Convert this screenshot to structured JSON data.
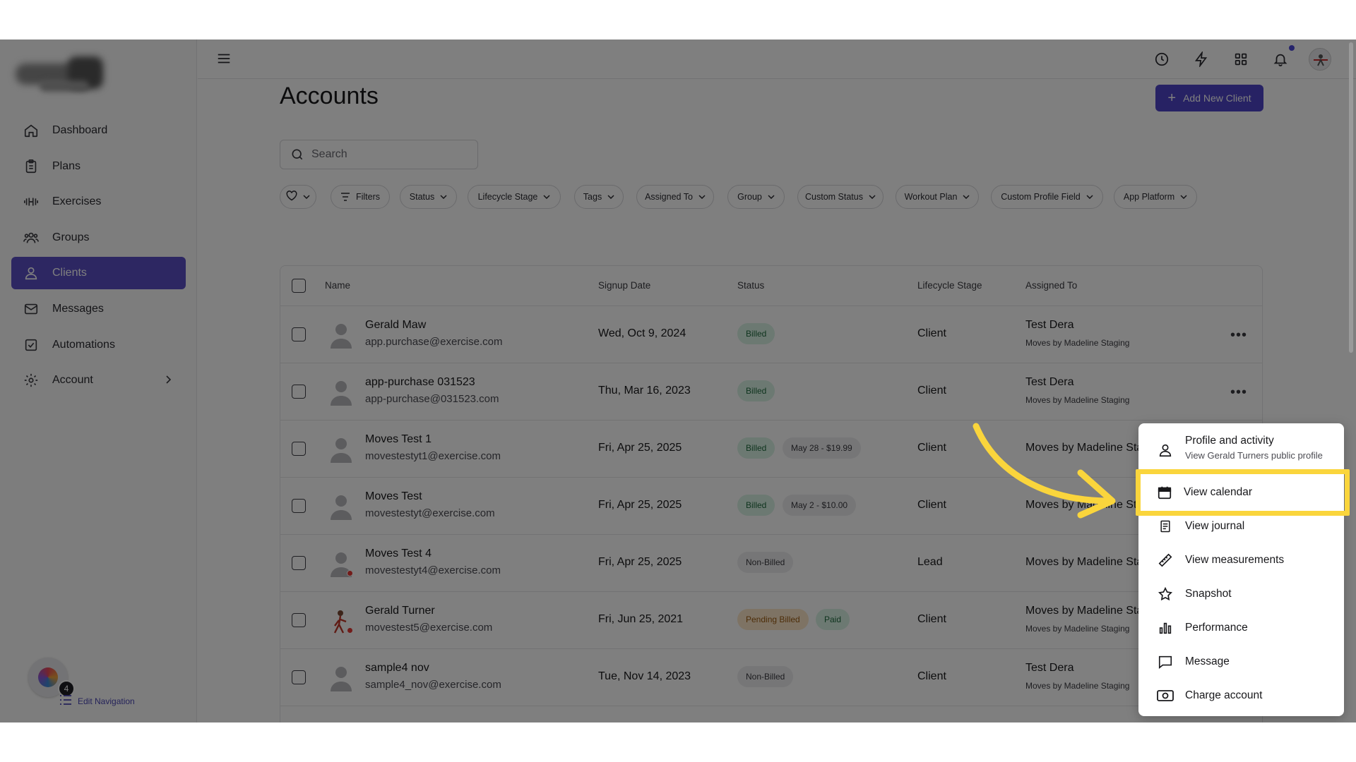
{
  "sidebar": {
    "items": [
      {
        "label": "Dashboard",
        "icon": "home-icon"
      },
      {
        "label": "Plans",
        "icon": "clipboard-icon"
      },
      {
        "label": "Exercises",
        "icon": "dumbbell-icon"
      },
      {
        "label": "Groups",
        "icon": "users-icon"
      },
      {
        "label": "Clients",
        "icon": "user-icon",
        "active": true
      },
      {
        "label": "Messages",
        "icon": "mail-icon"
      },
      {
        "label": "Automations",
        "icon": "check-square-icon"
      },
      {
        "label": "Account",
        "icon": "gear-icon"
      }
    ],
    "notification_count": "4",
    "edit_nav_label": "Edit Navigation"
  },
  "main": {
    "title": "Accounts",
    "add_button": "Add New Client",
    "search_placeholder": "Search",
    "filters": [
      "Filters",
      "Status",
      "Lifecycle Stage",
      "Tags",
      "Assigned To",
      "Group",
      "Custom Status",
      "Workout Plan",
      "Custom Profile Field",
      "App Platform"
    ]
  },
  "table": {
    "headers": {
      "name": "Name",
      "signup": "Signup Date",
      "status": "Status",
      "stage": "Lifecycle Stage",
      "assigned": "Assigned To"
    },
    "rows": [
      {
        "name": "Gerald Maw",
        "email": "app.purchase@exercise.com",
        "date": "Wed, Oct 9, 2024",
        "status": [
          "Billed"
        ],
        "stage": "Client",
        "assigned": "Test Dera",
        "assigned_sub": "Moves by Madeline Staging"
      },
      {
        "name": "app-purchase 031523",
        "email": "app-purchase@031523.com",
        "date": "Thu, Mar 16, 2023",
        "status": [
          "Billed"
        ],
        "stage": "Client",
        "assigned": "Test Dera",
        "assigned_sub": "Moves by Madeline Staging"
      },
      {
        "name": "Moves Test 1",
        "email": "movestestyt1@exercise.com",
        "date": "Fri, Apr 25, 2025",
        "status": [
          "Billed",
          "May 28 - $19.99"
        ],
        "stage": "Client",
        "assigned": "Moves by Madeline Stag"
      },
      {
        "name": "Moves Test",
        "email": "movestestyt@exercise.com",
        "date": "Fri, Apr 25, 2025",
        "status": [
          "Billed",
          "May 2 - $10.00"
        ],
        "stage": "Client",
        "assigned": "Moves by Madeline Sta"
      },
      {
        "name": "Moves Test 4",
        "email": "movestestyt4@exercise.com",
        "date": "Fri, Apr 25, 2025",
        "status": [
          "Non-Billed"
        ],
        "stage": "Lead",
        "assigned": "Moves by Madeline Stag"
      },
      {
        "name": "Gerald Turner",
        "email": "movestest5@exercise.com",
        "date": "Fri, Jun 25, 2021",
        "status": [
          "Pending Billed",
          "Paid"
        ],
        "stage": "Client",
        "assigned": "Moves by Madeline Stag",
        "assigned_sub": "Moves by Madeline Staging"
      },
      {
        "name": "sample4 nov",
        "email": "sample4_nov@exercise.com",
        "date": "Tue, Nov 14, 2023",
        "status": [
          "Non-Billed"
        ],
        "stage": "Client",
        "assigned": "Test Dera",
        "assigned_sub": "Moves by Madeline Staging"
      }
    ]
  },
  "context_menu": {
    "profile_label": "Profile and activity",
    "profile_sub": "View Gerald Turners public profile",
    "items": [
      {
        "label": "View calendar",
        "icon": "calendar-icon"
      },
      {
        "label": "View journal",
        "icon": "journal-icon"
      },
      {
        "label": "View measurements",
        "icon": "ruler-icon"
      },
      {
        "label": "Snapshot",
        "icon": "star-icon"
      },
      {
        "label": "Performance",
        "icon": "bar-chart-icon"
      },
      {
        "label": "Message",
        "icon": "message-icon"
      },
      {
        "label": "Charge account",
        "icon": "cash-icon"
      }
    ]
  },
  "colors": {
    "accent": "#4e44c9",
    "highlight": "#fad53c",
    "billed": "#d9f2e4",
    "pending": "#fde6c8"
  }
}
